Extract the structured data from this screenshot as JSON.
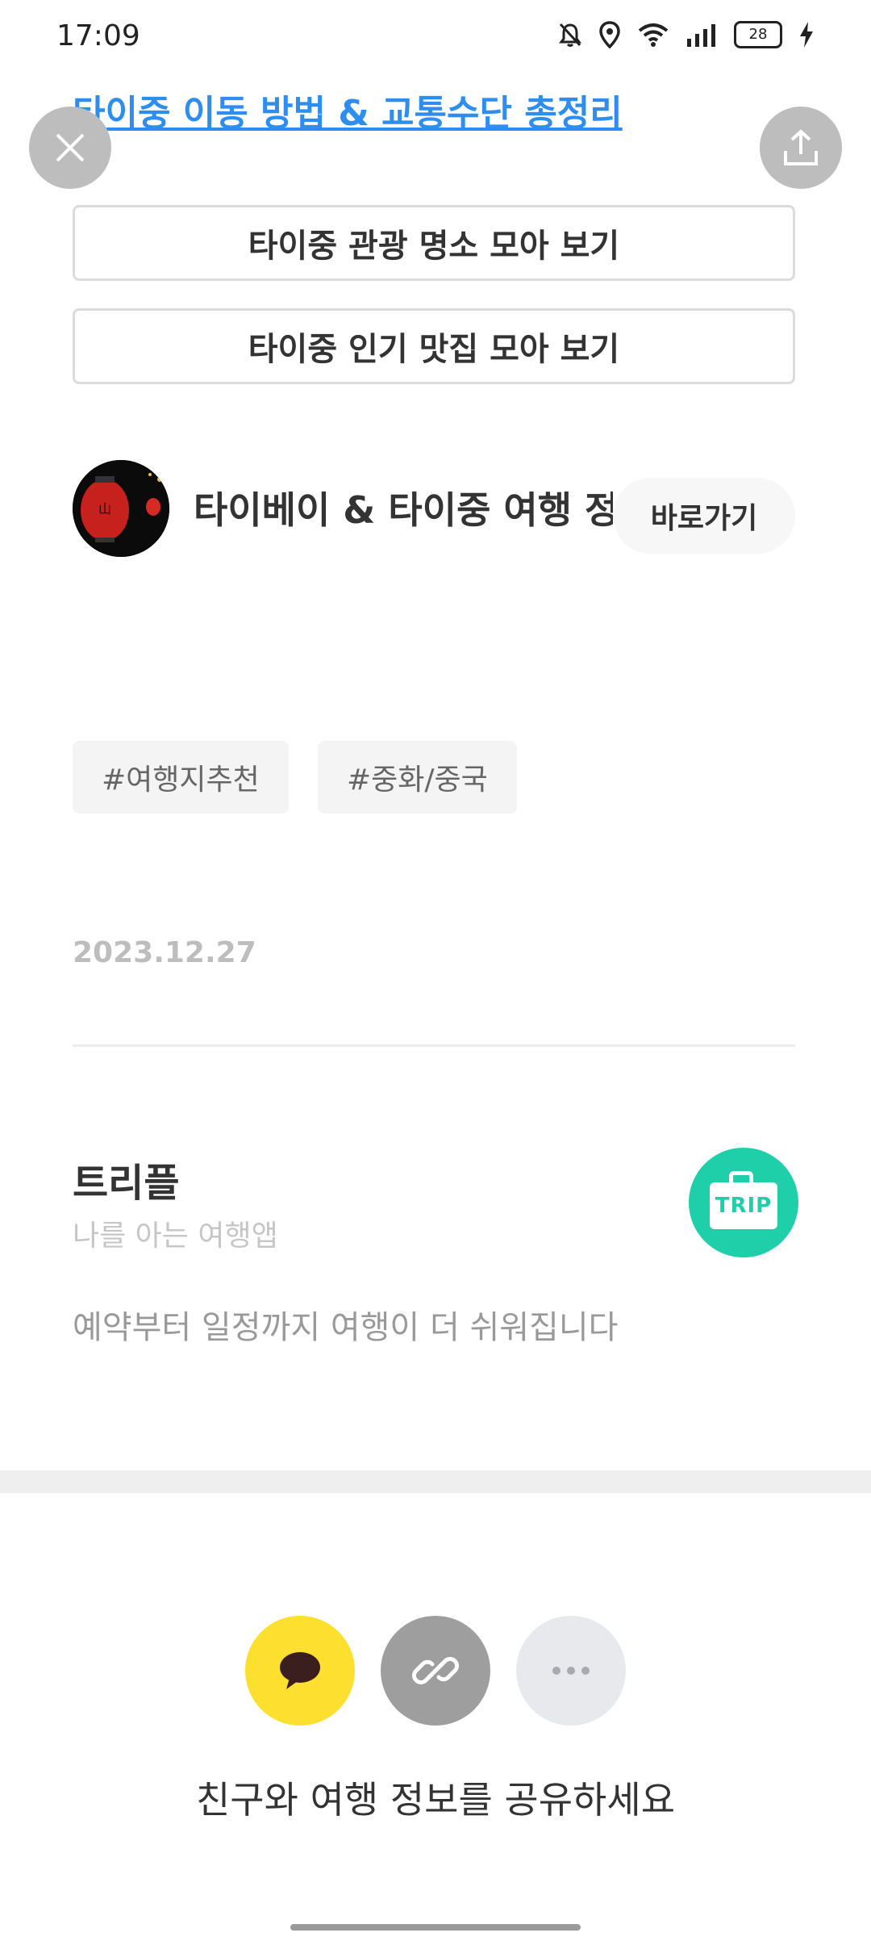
{
  "status": {
    "time": "17:09",
    "battery": "28"
  },
  "top_link": "타이중 이동 방법 & 교통수단 총정리",
  "buttons": {
    "attractions": "타이중 관광 명소 모아 보기",
    "restaurants": "타이중 인기 맛집 모아 보기"
  },
  "channel": {
    "name": "타이베이 & 타이중 여행 정보",
    "goto_label": "바로가기"
  },
  "tags": [
    "#여행지추천",
    "#중화/중국"
  ],
  "post_date": "2023.12.27",
  "promo": {
    "title": "트리플",
    "subtitle": "나를 아는 여행앱",
    "description": "예약부터 일정까지 여행이 더 쉬워집니다",
    "logo_text": "TRIP"
  },
  "share": {
    "text": "친구와 여행 정보를 공유하세요"
  },
  "colors": {
    "link": "#2d8ef0",
    "kakao": "#fde02f",
    "trip": "#1ecfaa"
  },
  "icons": [
    "bell-off-icon",
    "location-icon",
    "wifi-icon",
    "signal-icon",
    "battery-icon",
    "charging-icon",
    "close-icon",
    "share-icon",
    "chat-bubble-icon",
    "link-icon",
    "more-icon"
  ]
}
